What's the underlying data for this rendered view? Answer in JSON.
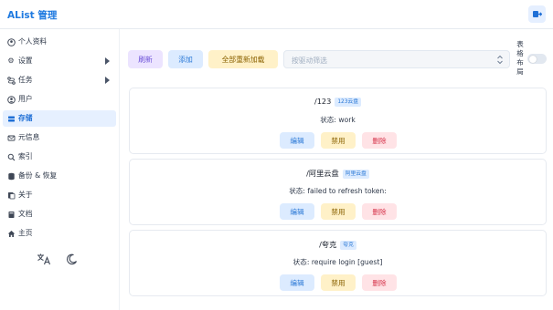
{
  "header": {
    "title": "AList 管理",
    "logout_icon": "logout-icon",
    "accent": "#1f7ae0"
  },
  "sidebar": {
    "items": [
      {
        "label": "个人资料",
        "icon": "user-circle-icon",
        "has_submenu": false,
        "active": false
      },
      {
        "label": "设置",
        "icon": "gear-icon",
        "has_submenu": true,
        "active": false
      },
      {
        "label": "任务",
        "icon": "route-icon",
        "has_submenu": true,
        "active": false
      },
      {
        "label": "用户",
        "icon": "user-icon",
        "has_submenu": false,
        "active": false
      },
      {
        "label": "存储",
        "icon": "database-icon",
        "has_submenu": false,
        "active": true
      },
      {
        "label": "元信息",
        "icon": "meta-icon",
        "has_submenu": false,
        "active": false
      },
      {
        "label": "索引",
        "icon": "search-icon",
        "has_submenu": false,
        "active": false
      },
      {
        "label": "备份 & 恢复",
        "icon": "backup-icon",
        "has_submenu": false,
        "active": false
      },
      {
        "label": "关于",
        "icon": "info-icon",
        "has_submenu": false,
        "active": false
      },
      {
        "label": "文档",
        "icon": "book-icon",
        "has_submenu": false,
        "active": false
      },
      {
        "label": "主页",
        "icon": "home-icon",
        "has_submenu": false,
        "active": false
      }
    ],
    "tools": [
      "translate-icon",
      "moon-icon"
    ]
  },
  "toolbar": {
    "refresh_label": "刷新",
    "add_label": "添加",
    "reload_all_label": "全部重新加载",
    "filter_placeholder": "按驱动筛选",
    "layout_label": "表格布局",
    "table_layout_enabled": false
  },
  "storages": [
    {
      "path": "/123",
      "driver": "123云盘",
      "status": "状态: work"
    },
    {
      "path": "/阿里云盘",
      "driver": "阿里云盘",
      "status": "状态: failed to refresh token:"
    },
    {
      "path": "/夸克",
      "driver": "夸克",
      "status": "状态: require login [guest]"
    }
  ],
  "card_actions": {
    "edit": "编辑",
    "disable": "禁用",
    "delete": "删除"
  }
}
